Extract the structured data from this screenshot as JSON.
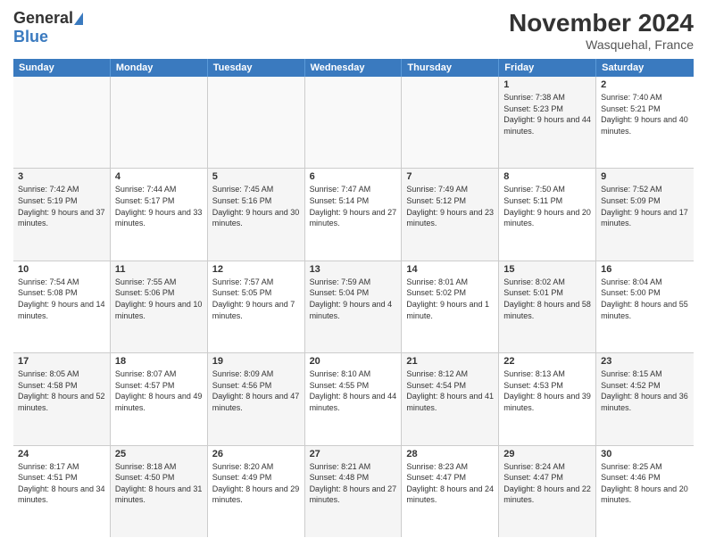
{
  "logo": {
    "line1": "General",
    "line2": "Blue"
  },
  "header": {
    "title": "November 2024",
    "subtitle": "Wasquehal, France"
  },
  "days_of_week": [
    "Sunday",
    "Monday",
    "Tuesday",
    "Wednesday",
    "Thursday",
    "Friday",
    "Saturday"
  ],
  "weeks": [
    [
      {
        "day": "",
        "info": "",
        "empty": true
      },
      {
        "day": "",
        "info": "",
        "empty": true
      },
      {
        "day": "",
        "info": "",
        "empty": true
      },
      {
        "day": "",
        "info": "",
        "empty": true
      },
      {
        "day": "",
        "info": "",
        "empty": true
      },
      {
        "day": "1",
        "info": "Sunrise: 7:38 AM\nSunset: 5:23 PM\nDaylight: 9 hours and 44 minutes.",
        "shaded": true
      },
      {
        "day": "2",
        "info": "Sunrise: 7:40 AM\nSunset: 5:21 PM\nDaylight: 9 hours and 40 minutes.",
        "shaded": false
      }
    ],
    [
      {
        "day": "3",
        "info": "Sunrise: 7:42 AM\nSunset: 5:19 PM\nDaylight: 9 hours and 37 minutes.",
        "shaded": true
      },
      {
        "day": "4",
        "info": "Sunrise: 7:44 AM\nSunset: 5:17 PM\nDaylight: 9 hours and 33 minutes.",
        "shaded": false
      },
      {
        "day": "5",
        "info": "Sunrise: 7:45 AM\nSunset: 5:16 PM\nDaylight: 9 hours and 30 minutes.",
        "shaded": true
      },
      {
        "day": "6",
        "info": "Sunrise: 7:47 AM\nSunset: 5:14 PM\nDaylight: 9 hours and 27 minutes.",
        "shaded": false
      },
      {
        "day": "7",
        "info": "Sunrise: 7:49 AM\nSunset: 5:12 PM\nDaylight: 9 hours and 23 minutes.",
        "shaded": true
      },
      {
        "day": "8",
        "info": "Sunrise: 7:50 AM\nSunset: 5:11 PM\nDaylight: 9 hours and 20 minutes.",
        "shaded": false
      },
      {
        "day": "9",
        "info": "Sunrise: 7:52 AM\nSunset: 5:09 PM\nDaylight: 9 hours and 17 minutes.",
        "shaded": true
      }
    ],
    [
      {
        "day": "10",
        "info": "Sunrise: 7:54 AM\nSunset: 5:08 PM\nDaylight: 9 hours and 14 minutes.",
        "shaded": false
      },
      {
        "day": "11",
        "info": "Sunrise: 7:55 AM\nSunset: 5:06 PM\nDaylight: 9 hours and 10 minutes.",
        "shaded": true
      },
      {
        "day": "12",
        "info": "Sunrise: 7:57 AM\nSunset: 5:05 PM\nDaylight: 9 hours and 7 minutes.",
        "shaded": false
      },
      {
        "day": "13",
        "info": "Sunrise: 7:59 AM\nSunset: 5:04 PM\nDaylight: 9 hours and 4 minutes.",
        "shaded": true
      },
      {
        "day": "14",
        "info": "Sunrise: 8:01 AM\nSunset: 5:02 PM\nDaylight: 9 hours and 1 minute.",
        "shaded": false
      },
      {
        "day": "15",
        "info": "Sunrise: 8:02 AM\nSunset: 5:01 PM\nDaylight: 8 hours and 58 minutes.",
        "shaded": true
      },
      {
        "day": "16",
        "info": "Sunrise: 8:04 AM\nSunset: 5:00 PM\nDaylight: 8 hours and 55 minutes.",
        "shaded": false
      }
    ],
    [
      {
        "day": "17",
        "info": "Sunrise: 8:05 AM\nSunset: 4:58 PM\nDaylight: 8 hours and 52 minutes.",
        "shaded": true
      },
      {
        "day": "18",
        "info": "Sunrise: 8:07 AM\nSunset: 4:57 PM\nDaylight: 8 hours and 49 minutes.",
        "shaded": false
      },
      {
        "day": "19",
        "info": "Sunrise: 8:09 AM\nSunset: 4:56 PM\nDaylight: 8 hours and 47 minutes.",
        "shaded": true
      },
      {
        "day": "20",
        "info": "Sunrise: 8:10 AM\nSunset: 4:55 PM\nDaylight: 8 hours and 44 minutes.",
        "shaded": false
      },
      {
        "day": "21",
        "info": "Sunrise: 8:12 AM\nSunset: 4:54 PM\nDaylight: 8 hours and 41 minutes.",
        "shaded": true
      },
      {
        "day": "22",
        "info": "Sunrise: 8:13 AM\nSunset: 4:53 PM\nDaylight: 8 hours and 39 minutes.",
        "shaded": false
      },
      {
        "day": "23",
        "info": "Sunrise: 8:15 AM\nSunset: 4:52 PM\nDaylight: 8 hours and 36 minutes.",
        "shaded": true
      }
    ],
    [
      {
        "day": "24",
        "info": "Sunrise: 8:17 AM\nSunset: 4:51 PM\nDaylight: 8 hours and 34 minutes.",
        "shaded": false
      },
      {
        "day": "25",
        "info": "Sunrise: 8:18 AM\nSunset: 4:50 PM\nDaylight: 8 hours and 31 minutes.",
        "shaded": true
      },
      {
        "day": "26",
        "info": "Sunrise: 8:20 AM\nSunset: 4:49 PM\nDaylight: 8 hours and 29 minutes.",
        "shaded": false
      },
      {
        "day": "27",
        "info": "Sunrise: 8:21 AM\nSunset: 4:48 PM\nDaylight: 8 hours and 27 minutes.",
        "shaded": true
      },
      {
        "day": "28",
        "info": "Sunrise: 8:23 AM\nSunset: 4:47 PM\nDaylight: 8 hours and 24 minutes.",
        "shaded": false
      },
      {
        "day": "29",
        "info": "Sunrise: 8:24 AM\nSunset: 4:47 PM\nDaylight: 8 hours and 22 minutes.",
        "shaded": true
      },
      {
        "day": "30",
        "info": "Sunrise: 8:25 AM\nSunset: 4:46 PM\nDaylight: 8 hours and 20 minutes.",
        "shaded": false
      }
    ]
  ]
}
